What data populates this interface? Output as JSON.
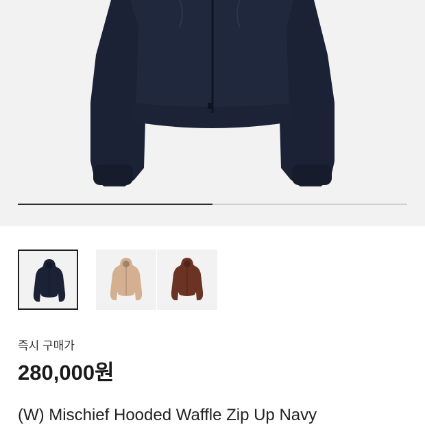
{
  "gallery": {
    "progress_fraction": 0.5,
    "main_image_icon": "navy-hooded-zip-jacket",
    "thumbnails": [
      {
        "color_name": "Navy",
        "color": "#1b2236",
        "selected": true
      },
      {
        "color_name": "Beige",
        "color": "#d4b091",
        "selected": false
      },
      {
        "color_name": "Brown",
        "color": "#6b3323",
        "selected": false
      }
    ]
  },
  "product": {
    "price_label": "즉시 구매가",
    "price": "280,000원",
    "title": "(W) Mischief Hooded Waffle Zip Up Navy"
  }
}
